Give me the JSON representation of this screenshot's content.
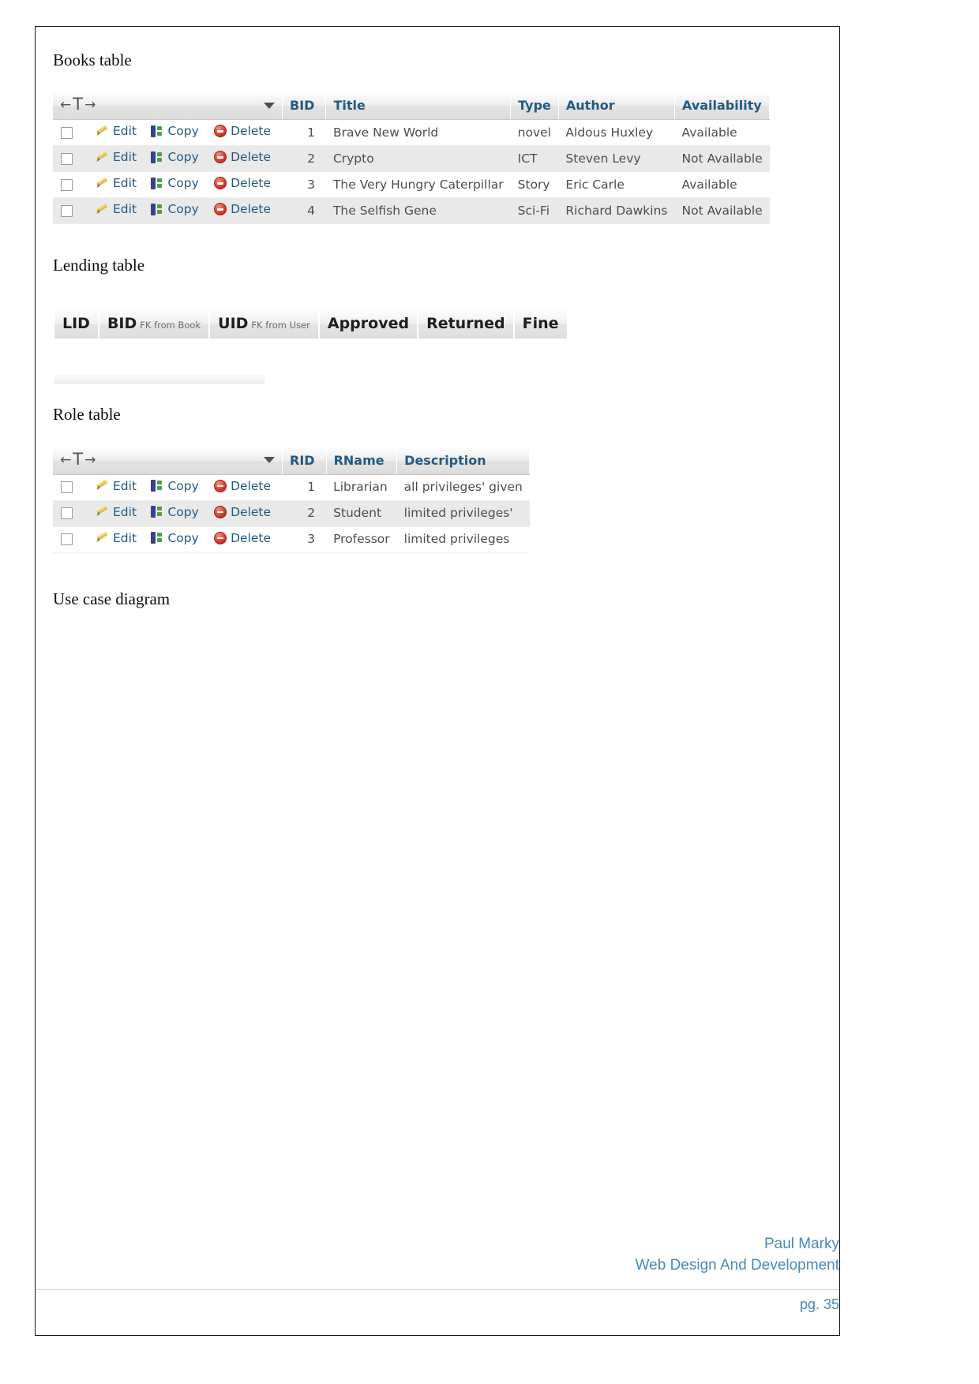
{
  "document": {
    "sections": [
      {
        "heading": "Books table"
      },
      {
        "heading": "Lending table"
      },
      {
        "heading": "Role table"
      },
      {
        "heading": "Use case diagram"
      }
    ]
  },
  "actions": {
    "edit": "Edit",
    "copy": "Copy",
    "delete": "Delete"
  },
  "books_table": {
    "nav_glyph": {
      "left_arrow": "←",
      "tee": "T",
      "right_arrow": "→"
    },
    "columns": [
      "BID",
      "Title",
      "Type",
      "Author",
      "Availability"
    ],
    "rows": [
      {
        "bid": "1",
        "title": "Brave New World",
        "type": "novel",
        "author": "Aldous Huxley",
        "availability": "Available"
      },
      {
        "bid": "2",
        "title": "Crypto",
        "type": "ICT",
        "author": "Steven Levy",
        "availability": "Not Available"
      },
      {
        "bid": "3",
        "title": "The Very Hungry Caterpillar",
        "type": "Story",
        "author": "Eric Carle",
        "availability": "Available"
      },
      {
        "bid": "4",
        "title": "The Selfish Gene",
        "type": "Sci-Fi",
        "author": "Richard Dawkins",
        "availability": "Not Available"
      }
    ]
  },
  "lending_table": {
    "columns": [
      {
        "label": "LID",
        "note": ""
      },
      {
        "label": "BID",
        "note": "FK from Book"
      },
      {
        "label": "UID",
        "note": "FK from User"
      },
      {
        "label": "Approved",
        "note": ""
      },
      {
        "label": "Returned",
        "note": ""
      },
      {
        "label": "Fine",
        "note": ""
      }
    ],
    "rows": []
  },
  "role_table": {
    "nav_glyph": {
      "left_arrow": "←",
      "tee": "T",
      "right_arrow": "→"
    },
    "columns": [
      "RID",
      "RName",
      "Description"
    ],
    "rows": [
      {
        "rid": "1",
        "rname": "Librarian",
        "description": "all privileges' given"
      },
      {
        "rid": "2",
        "rname": "Student",
        "description": "limited privileges'"
      },
      {
        "rid": "3",
        "rname": "Professor",
        "description": "limited privileges"
      }
    ]
  },
  "footer": {
    "author": "Paul Marky",
    "course": "Web Design And Development",
    "page_label": "pg. 35"
  },
  "colors": {
    "header_text": "#235a81",
    "footer_text": "#4a87bd",
    "row_even_bg": "#e9e9e9",
    "row_odd_bg": "#ffffff"
  }
}
